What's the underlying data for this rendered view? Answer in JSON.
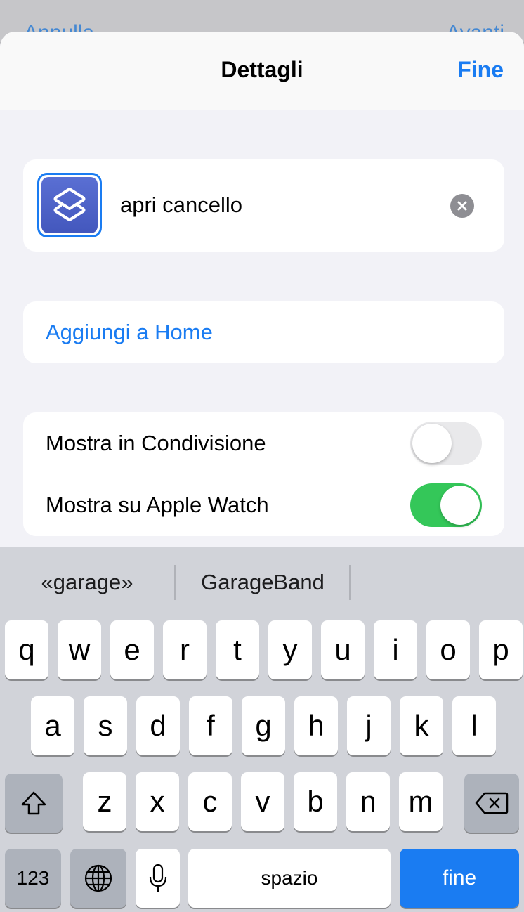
{
  "background_nav": {
    "left_label": "Annulla",
    "right_label": "Avanti"
  },
  "header": {
    "title": "Dettagli",
    "done_label": "Fine"
  },
  "shortcut": {
    "name_value": "apri cancello",
    "icon": "shortcuts-layers-icon",
    "icon_color": "#4f63c9"
  },
  "home": {
    "add_label": "Aggiungi a Home"
  },
  "toggles": [
    {
      "label": "Mostra in Condivisione",
      "on": false
    },
    {
      "label": "Mostra su Apple Watch",
      "on": true
    }
  ],
  "keyboard": {
    "suggestions": [
      "«garage»",
      "GarageBand",
      ""
    ],
    "row1": [
      "q",
      "w",
      "e",
      "r",
      "t",
      "y",
      "u",
      "i",
      "o",
      "p"
    ],
    "row2": [
      "a",
      "s",
      "d",
      "f",
      "g",
      "h",
      "j",
      "k",
      "l"
    ],
    "row3": [
      "z",
      "x",
      "c",
      "v",
      "b",
      "n",
      "m"
    ],
    "numbers_label": "123",
    "space_label": "spazio",
    "return_label": "fine"
  },
  "colors": {
    "accent": "#1a7cf2",
    "toggle_on": "#34c759",
    "sheet_bg": "#f2f2f7",
    "keyboard_bg": "#d1d3d9"
  }
}
